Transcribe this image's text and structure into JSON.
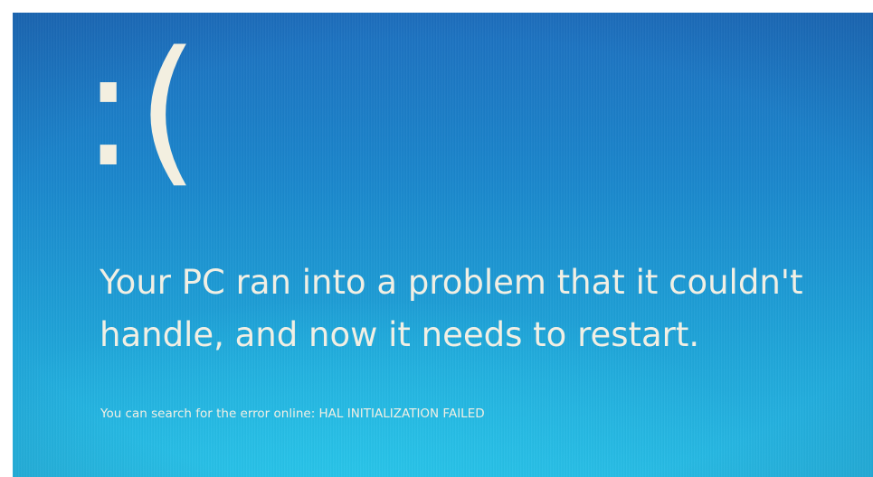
{
  "bsod": {
    "sad_face": ":(",
    "message": "Your PC ran into a problem that it couldn't handle, and now it needs to restart.",
    "search_prefix": "You can search for the error online: ",
    "error_code": "HAL INITIALIZATION FAILED"
  },
  "colors": {
    "background_top": "#1d6fbf",
    "background_bottom": "#26b9e3",
    "text": "#f1efe4"
  }
}
